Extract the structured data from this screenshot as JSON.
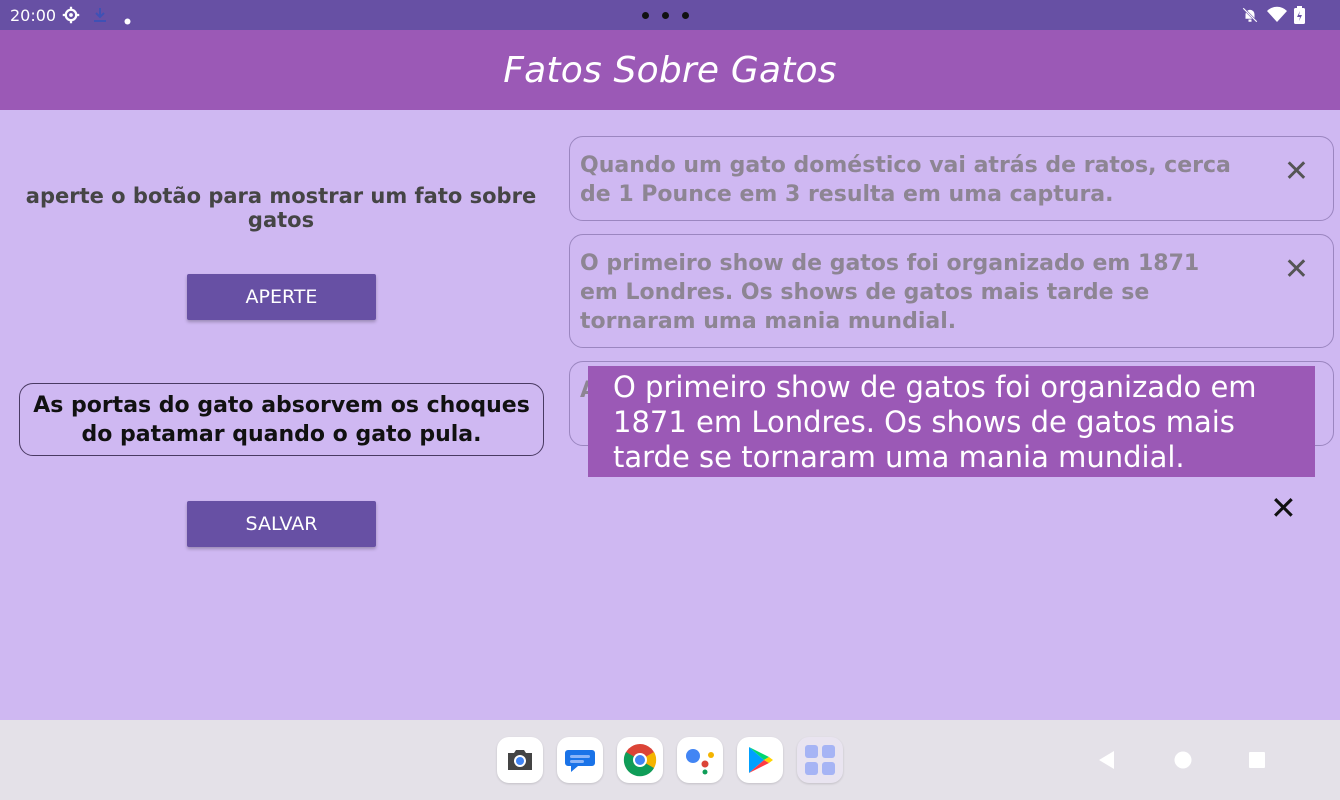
{
  "statusbar": {
    "time": "20:00",
    "icons": [
      "gear-icon",
      "download-icon",
      "notification-dot",
      "mute-bell-icon",
      "wifi-icon",
      "battery-icon"
    ]
  },
  "appbar": {
    "title": "Fatos Sobre Gatos"
  },
  "main": {
    "prompt": "aperte o botão para mostrar um fato sobre gatos",
    "aperte_label": "APERTE",
    "current_fact": "As portas do gato absorvem os choques do patamar quando o gato pula.",
    "salvar_label": "SALVAR"
  },
  "saved_facts": [
    {
      "text": "Quando um gato doméstico vai atrás de ratos, cerca de 1 Pounce em 3 resulta em uma captura."
    },
    {
      "text": "O primeiro show de gatos foi organizado em 1871 em Londres. Os shows de gatos mais tarde se tornaram uma mania mundial."
    },
    {
      "text": "A"
    }
  ],
  "toast": {
    "text": "O primeiro show de gatos foi organizado em 1871 em Londres. Os shows de gatos mais tarde se tornaram uma mania mundial."
  },
  "close_glyph": "✕",
  "dock": [
    "camera-icon",
    "messages-icon",
    "chrome-icon",
    "assistant-icon",
    "play-store-icon",
    "apps-grid-icon"
  ],
  "navigation": [
    "back-icon",
    "home-icon",
    "recents-icon"
  ],
  "colors": {
    "statusbar": "#6750a4",
    "appbar": "#9b59b6",
    "background": "#cfb8f2",
    "button": "#6750a4",
    "toast": "#9b59b6"
  }
}
